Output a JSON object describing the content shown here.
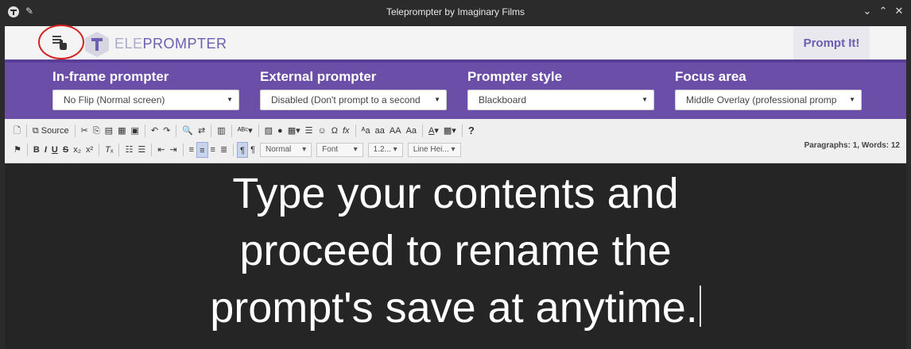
{
  "window": {
    "title": "Teleprompter by Imaginary Films",
    "pin_icon": "pin-icon",
    "controls": [
      "chevron-down-icon",
      "chevron-up-icon",
      "close-icon"
    ]
  },
  "header": {
    "logo_prefix": "ELE",
    "logo_suffix": "PROMPTER",
    "prompt_button": "Prompt It!",
    "colors": {
      "brand_purple": "#6a5fb0",
      "highlight_circle": "#d62020"
    }
  },
  "settings": {
    "in_frame": {
      "label": "In-frame prompter",
      "value": "No Flip (Normal screen)"
    },
    "external": {
      "label": "External prompter",
      "value": "Disabled (Don't prompt to a second"
    },
    "style": {
      "label": "Prompter style",
      "value": "Blackboard"
    },
    "focus": {
      "label": "Focus area",
      "value": "Middle Overlay (professional promp"
    },
    "band_color": "#6a4ea8"
  },
  "toolbar": {
    "source_label": "Source",
    "format_combo": "Normal",
    "font_combo": "Font",
    "size_combo": "1.2...",
    "line_height_combo": "Line Hei...",
    "help_label": "?",
    "stats": "Paragraphs: 1, Words: 12"
  },
  "editor": {
    "line1": "Type your contents and",
    "line2": "proceed to rename the",
    "line3": "prompt's save at anytime."
  }
}
